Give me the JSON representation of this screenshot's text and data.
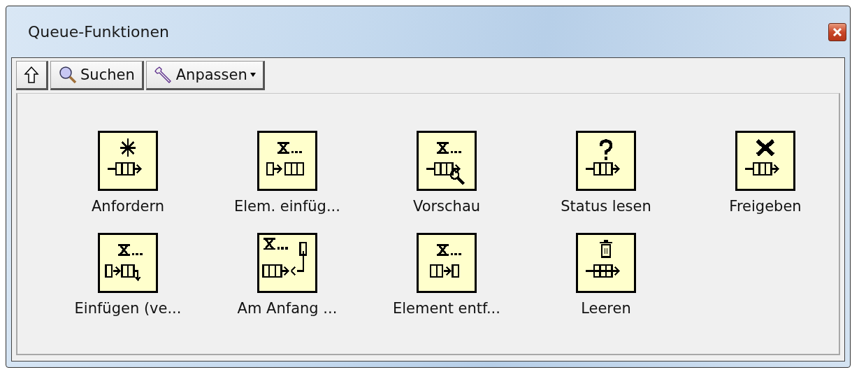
{
  "window": {
    "title": "Queue-Funktionen"
  },
  "toolbar": [
    {
      "kind": "up"
    },
    {
      "kind": "search",
      "label": "Suchen"
    },
    {
      "kind": "customize",
      "label": "Anpassen",
      "has_menu": true
    }
  ],
  "palette": [
    {
      "kind": "create",
      "label": "Anfordern"
    },
    {
      "kind": "enqueue",
      "label": "Elem. einfüg..."
    },
    {
      "kind": "preview",
      "label": "Vorschau"
    },
    {
      "kind": "status",
      "label": "Status lesen"
    },
    {
      "kind": "release",
      "label": "Freigeben"
    },
    {
      "kind": "lossy",
      "label": "Einfügen (ve..."
    },
    {
      "kind": "front",
      "label": "Am Anfang ..."
    },
    {
      "kind": "dequeue",
      "label": "Element entf..."
    },
    {
      "kind": "flush",
      "label": "Leeren"
    }
  ]
}
